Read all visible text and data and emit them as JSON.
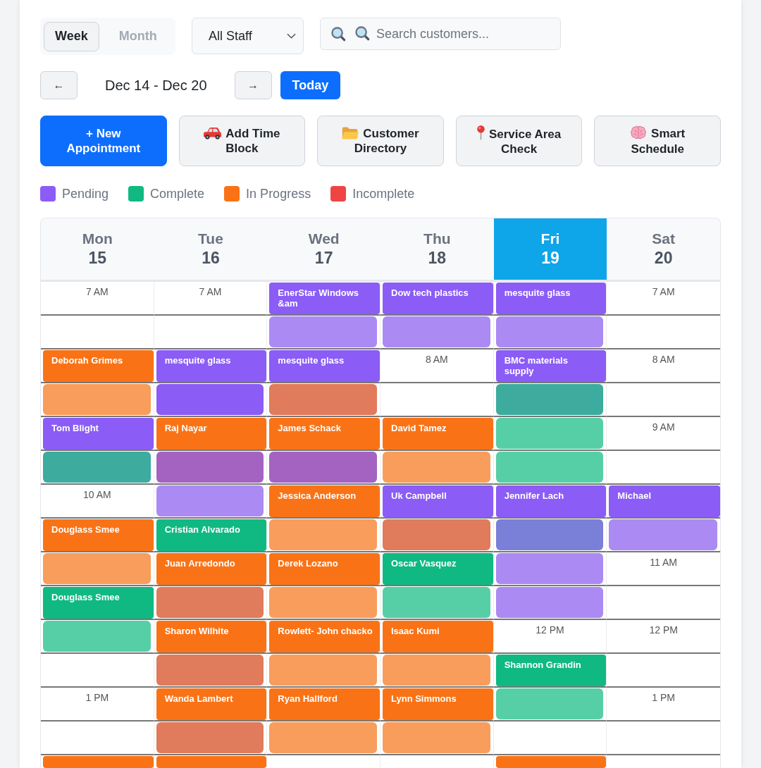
{
  "toolbar": {
    "view_toggle": [
      {
        "label": "Week",
        "selected": true
      },
      {
        "label": "Month",
        "selected": false
      }
    ],
    "staff_filter": {
      "value": "All Staff"
    },
    "search": {
      "placeholder": "Search customers..."
    }
  },
  "navigation": {
    "previous": "←",
    "range": "Dec 14 - Dec 20",
    "next": "→",
    "today": "Today"
  },
  "actions": [
    {
      "label": "+ New Appointment",
      "kind": "primary"
    },
    {
      "label": "Add Time Block",
      "kind": "secondary"
    },
    {
      "label": "Customer Directory",
      "kind": "secondary"
    },
    {
      "label": "Service Area Check",
      "kind": "secondary"
    },
    {
      "label": "Smart Schedule",
      "kind": "secondary"
    }
  ],
  "legend": [
    {
      "label": "Pending",
      "color": "#8b5cf6"
    },
    {
      "label": "Complete",
      "color": "#10b981"
    },
    {
      "label": "In Progress",
      "color": "#f97316"
    },
    {
      "label": "Incomplete",
      "color": "#ef4444"
    }
  ],
  "calendar": {
    "days": [
      {
        "weekday": "Mon",
        "date": "15",
        "selected": false
      },
      {
        "weekday": "Tue",
        "date": "16",
        "selected": false
      },
      {
        "weekday": "Wed",
        "date": "17",
        "selected": false
      },
      {
        "weekday": "Thu",
        "date": "18",
        "selected": false
      },
      {
        "weekday": "Fri",
        "date": "19",
        "selected": true
      },
      {
        "weekday": "Sat",
        "date": "20",
        "selected": false
      }
    ],
    "rows": [
      {
        "cells": [
          {
            "kind": "time",
            "label": "7 AM"
          },
          {
            "kind": "time",
            "label": "7 AM"
          },
          {
            "kind": "appointment",
            "name": "EnerStar Windows &am",
            "color": "#8b5cf6"
          },
          {
            "kind": "appointment",
            "name": "Dow tech plastics",
            "color": "#8b5cf6"
          },
          {
            "kind": "appointment",
            "name": "mesquite glass",
            "color": "#8b5cf6"
          },
          {
            "kind": "time",
            "label": "7 AM"
          }
        ]
      },
      {
        "cells": [
          {
            "kind": "empty"
          },
          {
            "kind": "empty"
          },
          {
            "kind": "continuation",
            "color": "#ab8af4"
          },
          {
            "kind": "continuation",
            "color": "#ab8af4"
          },
          {
            "kind": "continuation",
            "color": "#ab8af4"
          },
          {
            "kind": "empty"
          }
        ]
      },
      {
        "cells": [
          {
            "kind": "appointment",
            "name": "Deborah Grimes",
            "color": "#f97316"
          },
          {
            "kind": "appointment",
            "name": "mesquite glass",
            "color": "#8b5cf6"
          },
          {
            "kind": "appointment",
            "name": "mesquite glass",
            "color": "#8b5cf6"
          },
          {
            "kind": "time",
            "label": "8 AM"
          },
          {
            "kind": "appointment",
            "name": "BMC materials supply",
            "color": "#8b5cf6"
          },
          {
            "kind": "time",
            "label": "8 AM"
          }
        ]
      },
      {
        "cells": [
          {
            "kind": "continuation",
            "color": "#f89d5c"
          },
          {
            "kind": "continuation",
            "color": "#8b5cf6"
          },
          {
            "kind": "continuation",
            "color": "#e07b5b"
          },
          {
            "kind": "empty"
          },
          {
            "kind": "continuation",
            "color": "#3eab9f"
          },
          {
            "kind": "empty"
          }
        ]
      },
      {
        "cells": [
          {
            "kind": "appointment",
            "name": "Tom Blight",
            "color": "#8b5cf6"
          },
          {
            "kind": "appointment",
            "name": "Raj Nayar",
            "color": "#f97316"
          },
          {
            "kind": "appointment",
            "name": "James Schack",
            "color": "#f97316"
          },
          {
            "kind": "appointment",
            "name": "David Tamez",
            "color": "#f97316"
          },
          {
            "kind": "continuation",
            "color": "#57cfa6"
          },
          {
            "kind": "time",
            "label": "9 AM"
          }
        ]
      },
      {
        "cells": [
          {
            "kind": "continuation",
            "color": "#3eab9f"
          },
          {
            "kind": "continuation",
            "color": "#a463c0"
          },
          {
            "kind": "continuation",
            "color": "#a463c0"
          },
          {
            "kind": "continuation",
            "color": "#f89d5c"
          },
          {
            "kind": "continuation",
            "color": "#57cfa6"
          },
          {
            "kind": "empty"
          }
        ]
      },
      {
        "cells": [
          {
            "kind": "time",
            "label": "10 AM"
          },
          {
            "kind": "continuation",
            "color": "#ab8af4"
          },
          {
            "kind": "appointment",
            "name": "Jessica Anderson",
            "color": "#f97316"
          },
          {
            "kind": "appointment",
            "name": "Uk Campbell",
            "color": "#8b5cf6"
          },
          {
            "kind": "appointment",
            "name": "Jennifer Lach",
            "color": "#8b5cf6"
          },
          {
            "kind": "appointment",
            "name": "Michael",
            "color": "#8b5cf6"
          }
        ]
      },
      {
        "cells": [
          {
            "kind": "appointment",
            "name": "Douglass Smee",
            "color": "#f97316"
          },
          {
            "kind": "appointment",
            "name": "Cristian Alvarado",
            "color": "#10b981"
          },
          {
            "kind": "continuation",
            "color": "#f89d5c"
          },
          {
            "kind": "continuation",
            "color": "#e07b5b"
          },
          {
            "kind": "continuation",
            "color": "#7a7fd8"
          },
          {
            "kind": "continuation",
            "color": "#ab8af4"
          }
        ]
      },
      {
        "cells": [
          {
            "kind": "continuation",
            "color": "#f89d5c"
          },
          {
            "kind": "appointment",
            "name": "Juan Arredondo",
            "color": "#f97316"
          },
          {
            "kind": "appointment",
            "name": "Derek Lozano",
            "color": "#f97316"
          },
          {
            "kind": "appointment",
            "name": "Oscar Vasquez",
            "color": "#10b981"
          },
          {
            "kind": "continuation",
            "color": "#ab8af4"
          },
          {
            "kind": "time",
            "label": "11 AM"
          }
        ]
      },
      {
        "cells": [
          {
            "kind": "appointment",
            "name": "Douglass Smee",
            "color": "#10b981"
          },
          {
            "kind": "continuation",
            "color": "#e07b5b"
          },
          {
            "kind": "continuation",
            "color": "#f89d5c"
          },
          {
            "kind": "continuation",
            "color": "#57cfa6"
          },
          {
            "kind": "continuation",
            "color": "#ab8af4"
          },
          {
            "kind": "empty"
          }
        ]
      },
      {
        "cells": [
          {
            "kind": "continuation",
            "color": "#57cfa6"
          },
          {
            "kind": "appointment",
            "name": "Sharon Wilhite",
            "color": "#f97316"
          },
          {
            "kind": "appointment",
            "name": "Rowlett- John chacko",
            "color": "#f97316"
          },
          {
            "kind": "appointment",
            "name": "Isaac Kumi",
            "color": "#f97316"
          },
          {
            "kind": "time",
            "label": "12 PM"
          },
          {
            "kind": "time",
            "label": "12 PM"
          }
        ]
      },
      {
        "cells": [
          {
            "kind": "empty"
          },
          {
            "kind": "continuation",
            "color": "#e07b5b"
          },
          {
            "kind": "continuation",
            "color": "#f89d5c"
          },
          {
            "kind": "continuation",
            "color": "#f89d5c"
          },
          {
            "kind": "appointment",
            "name": "Shannon Grandin",
            "color": "#10b981"
          },
          {
            "kind": "empty"
          }
        ]
      },
      {
        "cells": [
          {
            "kind": "time",
            "label": "1 PM"
          },
          {
            "kind": "appointment",
            "name": "Wanda Lambert",
            "color": "#f97316"
          },
          {
            "kind": "appointment",
            "name": "Ryan Hallford",
            "color": "#f97316"
          },
          {
            "kind": "appointment",
            "name": "Lynn Simmons",
            "color": "#f97316"
          },
          {
            "kind": "continuation",
            "color": "#57cfa6"
          },
          {
            "kind": "time",
            "label": "1 PM"
          }
        ]
      },
      {
        "cells": [
          {
            "kind": "empty"
          },
          {
            "kind": "continuation",
            "color": "#e07b5b"
          },
          {
            "kind": "continuation",
            "color": "#f89d5c"
          },
          {
            "kind": "continuation",
            "color": "#f89d5c"
          },
          {
            "kind": "empty"
          },
          {
            "kind": "empty"
          }
        ]
      },
      {
        "cells": [
          {
            "kind": "appointment",
            "color": "#f97316"
          },
          {
            "kind": "appointment",
            "color": "#f97316"
          },
          {
            "kind": "empty"
          },
          {
            "kind": "empty"
          },
          {
            "kind": "appointment",
            "color": "#f97316"
          },
          {
            "kind": "empty"
          }
        ]
      }
    ]
  }
}
